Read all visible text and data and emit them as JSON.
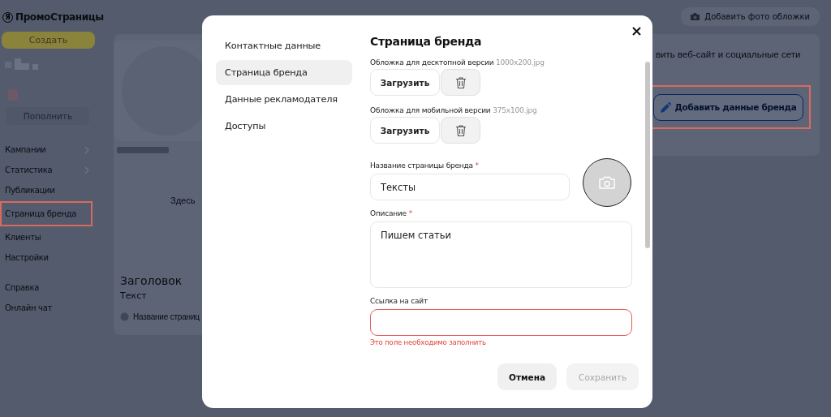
{
  "app": {
    "logo_mark": "Я",
    "title": "ПромоСтраницы"
  },
  "sidebar": {
    "create_button": "Создать",
    "top_up_button": "Пополнить",
    "items": [
      {
        "label": "Кампании",
        "has_submenu": true,
        "highlighted": false
      },
      {
        "label": "Статистика",
        "has_submenu": true,
        "highlighted": false
      },
      {
        "label": "Публикации",
        "has_submenu": false,
        "highlighted": false
      },
      {
        "label": "Страница бренда",
        "has_submenu": false,
        "highlighted": true
      },
      {
        "label": "Клиенты",
        "has_submenu": false,
        "highlighted": false
      },
      {
        "label": "Настройки",
        "has_submenu": false,
        "highlighted": false
      }
    ],
    "footer_items": [
      "Справка",
      "Онлайн чат"
    ]
  },
  "preview": {
    "placeholder_text": "Здесь",
    "heading": "Заголовок",
    "text": "Текст",
    "page_name": "Название страниц"
  },
  "header": {
    "add_cover_button": "Добавить фото обложки"
  },
  "brand_card": {
    "text": "вить веб-сайт и социальные сети",
    "add_brand_button": "Добавить данные бренда",
    "highlighted": true
  },
  "modal": {
    "nav": [
      {
        "label": "Контактные данные",
        "selected": false
      },
      {
        "label": "Страница бренда",
        "selected": true
      },
      {
        "label": "Данные рекламодателя",
        "selected": false
      },
      {
        "label": "Доступы",
        "selected": false
      }
    ],
    "title": "Страница бренда",
    "uploads": [
      {
        "label": "Обложка для десктопной версии",
        "hint": "1000x200.jpg",
        "button": "Загрузить"
      },
      {
        "label": "Обложка для мобильной версии",
        "hint": "375x100.jpg",
        "button": "Загрузить"
      }
    ],
    "fields": [
      {
        "kind": "input",
        "label": "Название страницы бренда",
        "required": true,
        "value": "Тексты",
        "invalid": false
      },
      {
        "kind": "textarea",
        "label": "Описание",
        "required": true,
        "value": "Пишем статьи",
        "invalid": false
      },
      {
        "kind": "input",
        "label": "Ссылка на сайт",
        "required": false,
        "invalid": true,
        "error": "Это поле необходимо заполнить"
      }
    ],
    "required_mark": "*",
    "buttons": [
      {
        "label": "Отмена",
        "disabled": false
      },
      {
        "label": "Сохранить",
        "disabled": true
      }
    ]
  }
}
